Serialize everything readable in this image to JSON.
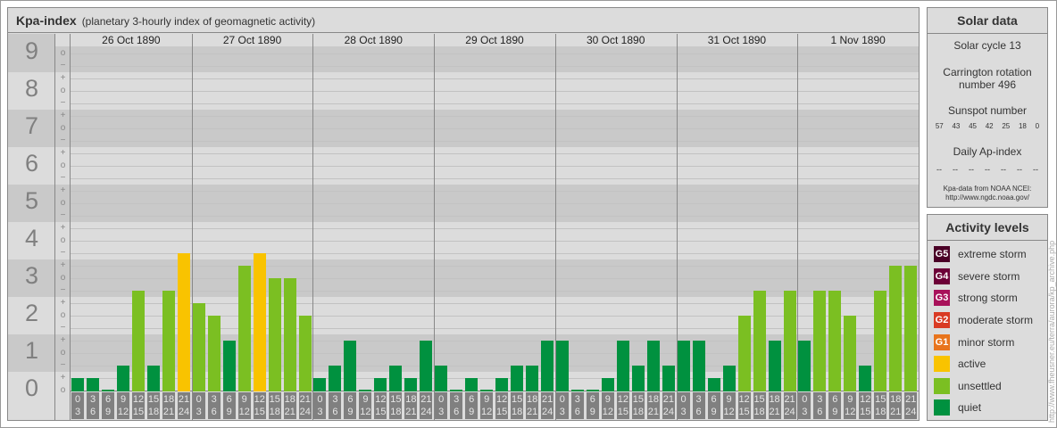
{
  "title": {
    "main": "Kpa-index",
    "subtitle": "(planetary 3-hourly index of geomagnetic activity)"
  },
  "chart_data": {
    "type": "bar",
    "title": "Kpa-index",
    "subtitle": "(planetary 3-hourly index of geomagnetic activity)",
    "ylim": [
      0,
      9
    ],
    "y_ticks": [
      "0",
      "1",
      "2",
      "3",
      "4",
      "5",
      "6",
      "7",
      "8",
      "9"
    ],
    "time_intervals": [
      [
        "0",
        "3"
      ],
      [
        "3",
        "6"
      ],
      [
        "6",
        "9"
      ],
      [
        "9",
        "12"
      ],
      [
        "12",
        "15"
      ],
      [
        "15",
        "18"
      ],
      [
        "18",
        "21"
      ],
      [
        "21",
        "24"
      ]
    ],
    "days": [
      {
        "date": "26 Oct 1890",
        "kp": [
          "0+",
          "0+",
          "0o",
          "1-",
          "3-",
          "1-",
          "3-",
          "4-"
        ]
      },
      {
        "date": "27 Oct 1890",
        "kp": [
          "2+",
          "2o",
          "1+",
          "3+",
          "4-",
          "3o",
          "3o",
          "2o"
        ]
      },
      {
        "date": "28 Oct 1890",
        "kp": [
          "0+",
          "1-",
          "1+",
          "0o",
          "0+",
          "1-",
          "0+",
          "1+"
        ]
      },
      {
        "date": "29 Oct 1890",
        "kp": [
          "1-",
          "0o",
          "0+",
          "0o",
          "0+",
          "1-",
          "1-",
          "1+"
        ]
      },
      {
        "date": "30 Oct 1890",
        "kp": [
          "1+",
          "0o",
          "0o",
          "0+",
          "1+",
          "1-",
          "1+",
          "1-"
        ]
      },
      {
        "date": "31 Oct 1890",
        "kp": [
          "1+",
          "1+",
          "0+",
          "1-",
          "2o",
          "3-",
          "1+",
          "3-"
        ]
      },
      {
        "date": "1 Nov 1890",
        "kp": [
          "1+",
          "3-",
          "3-",
          "2o",
          "1-",
          "3-",
          "3+",
          "3+"
        ]
      }
    ]
  },
  "colors": {
    "quiet": "#00913f",
    "unsettled": "#7bbf22",
    "active": "#f9c300",
    "G1": "#e8741c",
    "G2": "#d93a23",
    "G3": "#a8115a",
    "G4": "#6c0037",
    "G5": "#4a0026"
  },
  "solar": {
    "header": "Solar data",
    "cycle": "Solar cycle 13",
    "carrington_line1": "Carrington rotation",
    "carrington_line2": "number 496",
    "sunspot_label": "Sunspot number",
    "sunspots": [
      "57",
      "43",
      "45",
      "42",
      "25",
      "18",
      "0"
    ],
    "ap_label": "Daily Ap-index",
    "ap": [
      "--",
      "--",
      "--",
      "--",
      "--",
      "--",
      "--"
    ],
    "source_line1": "Kpa-data from NOAA NCEI:",
    "source_line2": "http://www.ngdc.noaa.gov/"
  },
  "legend": {
    "header": "Activity levels",
    "items": [
      {
        "badge": "G5",
        "label": "extreme storm",
        "color": "#4a0026"
      },
      {
        "badge": "G4",
        "label": "severe storm",
        "color": "#6c0037"
      },
      {
        "badge": "G3",
        "label": "strong storm",
        "color": "#a8115a"
      },
      {
        "badge": "G2",
        "label": "moderate storm",
        "color": "#d93a23"
      },
      {
        "badge": "G1",
        "label": "minor storm",
        "color": "#e8741c"
      },
      {
        "badge": "",
        "label": "active",
        "color": "#f9c300"
      },
      {
        "badge": "",
        "label": "unsettled",
        "color": "#7bbf22"
      },
      {
        "badge": "",
        "label": "quiet",
        "color": "#00913f"
      }
    ]
  },
  "credit": "http://www.fheusner.eu/terra/aurora/kp_archive.php"
}
